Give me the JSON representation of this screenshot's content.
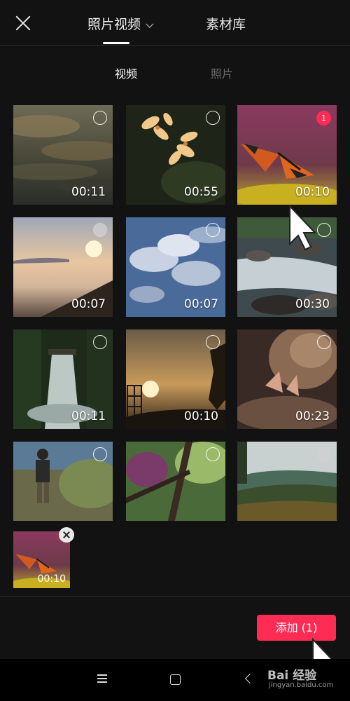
{
  "header": {
    "tabs": [
      {
        "label": "照片视频"
      },
      {
        "label": "素材库"
      }
    ]
  },
  "subtabs": [
    {
      "label": "视频"
    },
    {
      "label": "照片"
    }
  ],
  "media": [
    {
      "duration": "00:11",
      "scene": "cloudy-sky"
    },
    {
      "duration": "00:55",
      "scene": "flowers"
    },
    {
      "duration": "00:10",
      "scene": "butterfly",
      "selected_index": "1"
    },
    {
      "duration": "00:07",
      "scene": "sunset-sea"
    },
    {
      "duration": "00:07",
      "scene": "blue-sky-clouds"
    },
    {
      "duration": "00:30",
      "scene": "river-rocks"
    },
    {
      "duration": "00:11",
      "scene": "waterfall-forest"
    },
    {
      "duration": "00:10",
      "scene": "sunset-tower"
    },
    {
      "duration": "00:23",
      "scene": "bird-nest"
    },
    {
      "duration": "",
      "scene": "hiker"
    },
    {
      "duration": "",
      "scene": "green-branches"
    },
    {
      "duration": "",
      "scene": "mountain-valley"
    }
  ],
  "selection_tray": {
    "items": [
      {
        "duration": "00:10",
        "scene": "butterfly"
      }
    ]
  },
  "add_button": {
    "label": "添加 (1)"
  },
  "watermark": {
    "text": "Bai 经验",
    "sub": "jingyan.baidu.com"
  },
  "colors": {
    "accent": "#fe2c55",
    "background": "#121212"
  }
}
